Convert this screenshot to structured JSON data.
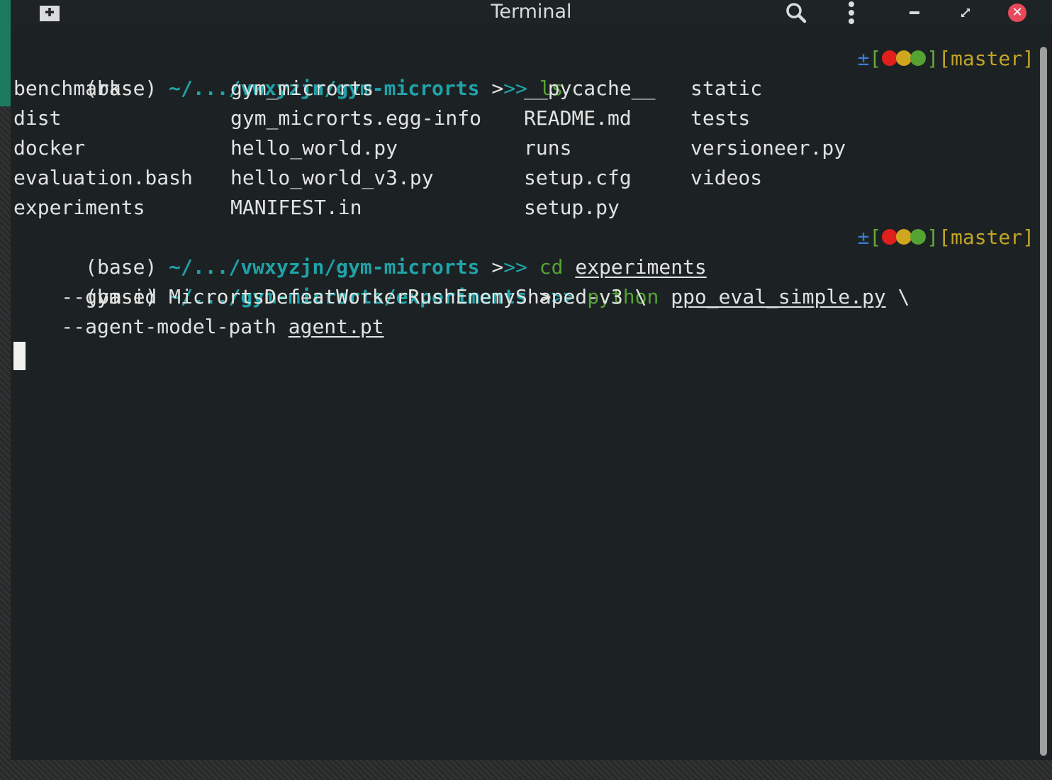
{
  "window": {
    "title": "Terminal",
    "icons": [
      "new-tab-icon",
      "search-icon",
      "menu-icon",
      "minimize-icon",
      "restore-icon",
      "close-icon"
    ]
  },
  "colors": {
    "path": "#1fa3a9",
    "command": "#55a332",
    "branch": "#c3a527",
    "dot_red": "#e0201c",
    "dot_yellow": "#d0a61f",
    "dot_green": "#55a332",
    "close": "#e8495a"
  },
  "prompt": {
    "env": "(base)",
    "arrows": [
      ">",
      ">>"
    ],
    "rprompt": {
      "symbol": "±",
      "open": "[",
      "close": "]",
      "branch": "[master]"
    }
  },
  "lines": {
    "l1": {
      "path": "~/.../vwxyzjn/gym-microrts",
      "cmd": "ls"
    },
    "l7": {
      "path": "~/.../vwxyzjn/gym-microrts",
      "cmd": "cd",
      "arg": "experiments"
    },
    "l8": {
      "path": "~/.../gym-microrts/experiments",
      "cmd": "python",
      "arg": "ppo_eval_simple.py",
      "cont": "\\"
    },
    "l9": {
      "text": "    --gym-id MicrortsDefeatWorkerRushEnemyShaped-v3 \\"
    },
    "l10": {
      "text": "    --agent-model-path ",
      "arg": "agent.pt"
    }
  },
  "ls_output": [
    [
      "benchmark",
      "gym_microrts",
      "__pycache__",
      "static"
    ],
    [
      "dist",
      "gym_microrts.egg-info",
      "README.md",
      "tests"
    ],
    [
      "docker",
      "hello_world.py",
      "runs",
      "versioneer.py"
    ],
    [
      "evaluation.bash",
      "hello_world_v3.py",
      "setup.cfg",
      "videos"
    ],
    [
      "experiments",
      "MANIFEST.in",
      "setup.py",
      ""
    ]
  ]
}
